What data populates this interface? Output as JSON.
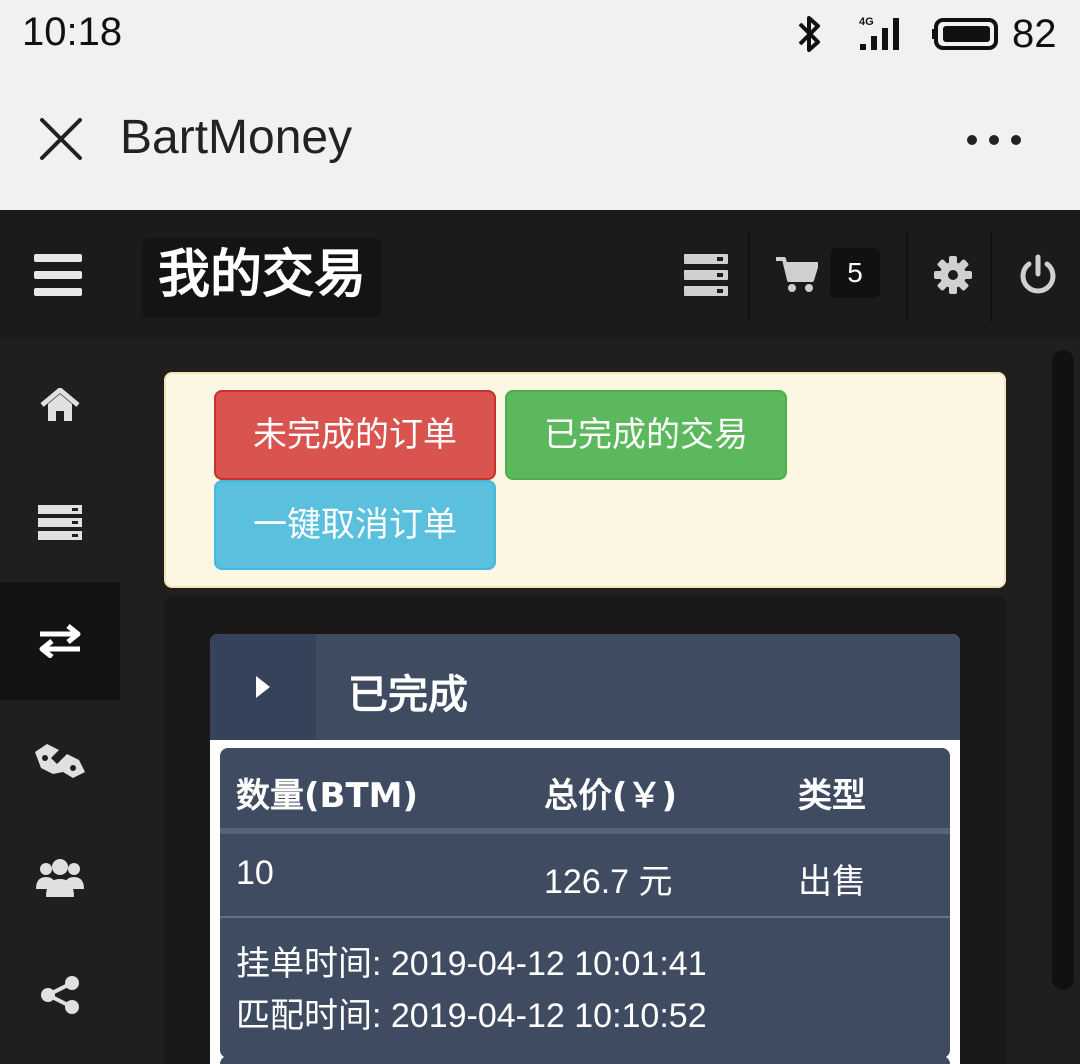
{
  "status_bar": {
    "time": "10:18",
    "battery": "82",
    "network": "4G"
  },
  "title_bar": {
    "title": "BartMoney"
  },
  "header": {
    "title": "我的交易",
    "cart_count": "5"
  },
  "sidebar": {
    "items": [
      {
        "icon": "home-icon"
      },
      {
        "icon": "server-list-icon"
      },
      {
        "icon": "exchange-arrows-icon",
        "active": true
      },
      {
        "icon": "handshake-icon"
      },
      {
        "icon": "users-icon"
      },
      {
        "icon": "share-icon"
      }
    ]
  },
  "actions": {
    "open_orders": "未完成的订单",
    "completed_trades": "已完成的交易",
    "cancel_all": "一键取消订单"
  },
  "panel": {
    "title": "已完成",
    "headers": {
      "qty": "数量(BTM)",
      "total": "总价(￥)",
      "type": "类型"
    },
    "row": {
      "qty": "10",
      "total": "126.7 元",
      "type": "出售",
      "listed": "挂单时间: 2019-04-12 10:01:41",
      "matched": "匹配时间: 2019-04-12 10:10:52"
    }
  },
  "colors": {
    "danger": "#d9534f",
    "success": "#5cb85c",
    "info": "#5bc0de",
    "card": "#3e4b61",
    "notice_bg": "#fcf7e3"
  }
}
